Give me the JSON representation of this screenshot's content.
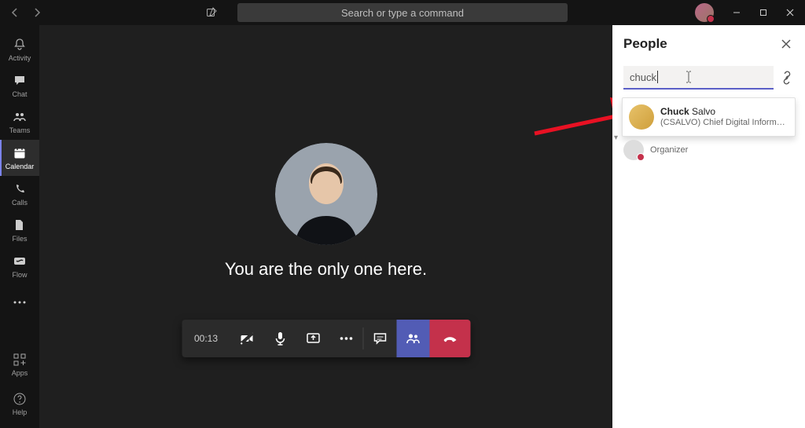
{
  "titlebar": {
    "search_placeholder": "Search or type a command"
  },
  "rail": {
    "items": [
      {
        "label": "Activity"
      },
      {
        "label": "Chat"
      },
      {
        "label": "Teams"
      },
      {
        "label": "Calendar"
      },
      {
        "label": "Calls"
      },
      {
        "label": "Files"
      },
      {
        "label": "Flow"
      }
    ],
    "apps_label": "Apps",
    "help_label": "Help"
  },
  "meeting": {
    "status_text": "You are the only one here.",
    "call_duration": "00:13"
  },
  "panel": {
    "title": "People",
    "search_value": "chuck",
    "suggestion": {
      "name_bold": "Chuck",
      "name_rest": " Salvo",
      "subtitle": "(CSALVO) Chief Digital Information Of…"
    },
    "organizer_label": "Organizer"
  }
}
